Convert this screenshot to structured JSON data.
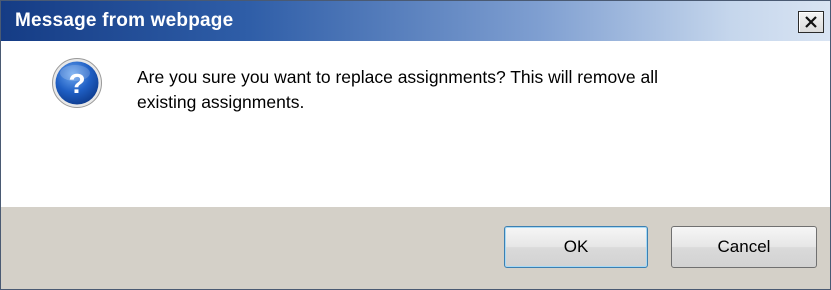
{
  "dialog": {
    "title": "Message from webpage",
    "close_symbol": "X",
    "icon": "question-icon",
    "icon_glyph": "?",
    "message_line1": "Are you sure you want to replace assignments? This will remove all",
    "message_line2": "existing assignments.",
    "ok_label": "OK",
    "cancel_label": "Cancel"
  },
  "colors": {
    "title_gradient_start": "#153c85",
    "title_gradient_end": "#d9e4f3",
    "footer_bg": "#d4d0c8",
    "icon_blue": "#1f5fc4"
  }
}
